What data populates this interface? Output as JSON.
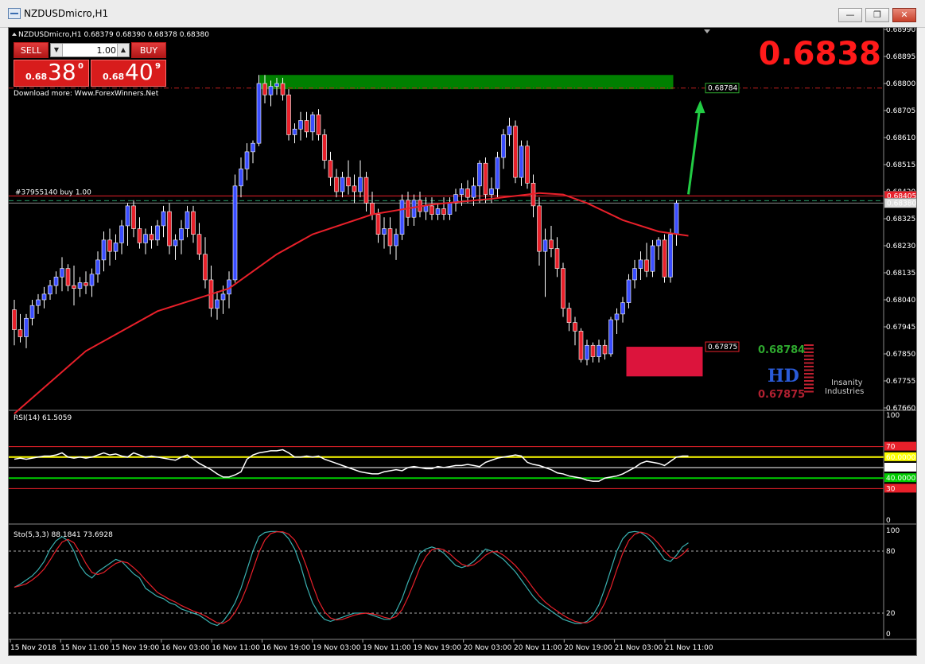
{
  "window": {
    "title": "NZDUSDmicro,H1",
    "controls": {
      "minimize": "—",
      "restore": "❐",
      "close": "✕"
    }
  },
  "chart": {
    "header": "NZDUSDmicro,H1  0.68379 0.68390 0.68378 0.68380",
    "big_price": "0.6838",
    "watermark_text": "Download more: Www.ForexWinners.Net",
    "order_line_label": "#37955140 buy 1.00",
    "trade_panel": {
      "sell_label": "SELL",
      "buy_label": "BUY",
      "lot_value": "1.00",
      "sell_quote": {
        "small": "0.68",
        "big": "38",
        "sup": "0"
      },
      "buy_quote": {
        "small": "0.68",
        "big": "40",
        "sup": "9"
      }
    },
    "price_axis": [
      "0.68990",
      "0.68895",
      "0.68800",
      "0.68705",
      "0.68610",
      "0.68515",
      "0.68420",
      "0.68325",
      "0.68230",
      "0.68135",
      "0.68040",
      "0.67945",
      "0.67850",
      "0.67755",
      "0.67660"
    ],
    "price_tags": {
      "order": "0.68405",
      "bid": "0.68380",
      "target": "0.68784",
      "stop": "0.67875"
    },
    "levels_legend": {
      "upper": "0.68784",
      "lower": "0.67875"
    },
    "logo": {
      "letters": "HD",
      "text1": "Insanity",
      "text2": "Industries"
    },
    "time_axis": [
      "15 Nov 2018",
      "15 Nov 11:00",
      "15 Nov 19:00",
      "16 Nov 03:00",
      "16 Nov 11:00",
      "16 Nov 19:00",
      "19 Nov 03:00",
      "19 Nov 11:00",
      "19 Nov 19:00",
      "20 Nov 03:00",
      "20 Nov 11:00",
      "20 Nov 19:00",
      "21 Nov 03:00",
      "21 Nov 11:00"
    ],
    "colors": {
      "bull": "#3a4dff",
      "bear": "#e8202a",
      "ma": "#e8202a",
      "target_zone": "#008000",
      "stop_zone": "#dc143c",
      "arrow": "#22cc44"
    }
  },
  "rsi": {
    "label": "RSI(14) 61.5059",
    "axis": [
      "100",
      "70",
      "60.0000",
      "50.0000",
      "40.0000",
      "30",
      "0"
    ]
  },
  "stochastic": {
    "label": "Sto(5,3,3) 88.1841 73.6928",
    "axis": [
      "100",
      "80",
      "20",
      "0"
    ]
  },
  "chart_data": {
    "type": "candlestick",
    "symbol": "NZDUSDmicro",
    "timeframe": "H1",
    "ylim": [
      0.6766,
      0.6899
    ],
    "candles": [
      [
        0.68005,
        0.6804,
        0.6788,
        0.67935
      ],
      [
        0.67935,
        0.6799,
        0.6789,
        0.6791
      ],
      [
        0.6791,
        0.6799,
        0.6787,
        0.67975
      ],
      [
        0.67975,
        0.6804,
        0.6795,
        0.6802
      ],
      [
        0.6802,
        0.6806,
        0.6799,
        0.6804
      ],
      [
        0.6804,
        0.68085,
        0.6801,
        0.6806
      ],
      [
        0.6806,
        0.6811,
        0.6804,
        0.6809
      ],
      [
        0.6809,
        0.6814,
        0.6806,
        0.6812
      ],
      [
        0.6812,
        0.6819,
        0.6807,
        0.6815
      ],
      [
        0.6815,
        0.68165,
        0.6807,
        0.6809
      ],
      [
        0.6809,
        0.6816,
        0.6802,
        0.6808
      ],
      [
        0.6808,
        0.6812,
        0.6805,
        0.681
      ],
      [
        0.681,
        0.6814,
        0.6806,
        0.6809
      ],
      [
        0.6809,
        0.6815,
        0.6805,
        0.6813
      ],
      [
        0.6813,
        0.6821,
        0.681,
        0.6818
      ],
      [
        0.6818,
        0.6828,
        0.6814,
        0.6825
      ],
      [
        0.6825,
        0.6829,
        0.6816,
        0.6821
      ],
      [
        0.6821,
        0.6827,
        0.6818,
        0.6824
      ],
      [
        0.6824,
        0.6832,
        0.682,
        0.683
      ],
      [
        0.683,
        0.6838,
        0.6823,
        0.6837
      ],
      [
        0.6837,
        0.6839,
        0.6826,
        0.6829
      ],
      [
        0.6829,
        0.6833,
        0.6822,
        0.6824
      ],
      [
        0.6824,
        0.6829,
        0.682,
        0.6827
      ],
      [
        0.6827,
        0.683,
        0.6822,
        0.6825
      ],
      [
        0.6825,
        0.6832,
        0.6823,
        0.683
      ],
      [
        0.683,
        0.6837,
        0.6826,
        0.6835
      ],
      [
        0.6835,
        0.6838,
        0.682,
        0.6823
      ],
      [
        0.6823,
        0.6827,
        0.6818,
        0.6825
      ],
      [
        0.6825,
        0.6832,
        0.682,
        0.6829
      ],
      [
        0.6829,
        0.6837,
        0.6826,
        0.6835
      ],
      [
        0.6835,
        0.6837,
        0.6824,
        0.6827
      ],
      [
        0.6827,
        0.6831,
        0.6818,
        0.682
      ],
      [
        0.682,
        0.6826,
        0.6808,
        0.6811
      ],
      [
        0.6811,
        0.6816,
        0.6798,
        0.6801
      ],
      [
        0.6801,
        0.6807,
        0.6797,
        0.6804
      ],
      [
        0.6804,
        0.6809,
        0.6799,
        0.6806
      ],
      [
        0.6806,
        0.6814,
        0.6801,
        0.6811
      ],
      [
        0.6811,
        0.6848,
        0.681,
        0.6844
      ],
      [
        0.6844,
        0.6854,
        0.684,
        0.685
      ],
      [
        0.685,
        0.6859,
        0.6846,
        0.6856
      ],
      [
        0.6856,
        0.686,
        0.6852,
        0.6859
      ],
      [
        0.6859,
        0.6883,
        0.6858,
        0.688
      ],
      [
        0.688,
        0.6883,
        0.6873,
        0.6876
      ],
      [
        0.6876,
        0.6881,
        0.6872,
        0.6879
      ],
      [
        0.6879,
        0.6882,
        0.6876,
        0.688
      ],
      [
        0.688,
        0.6882,
        0.6874,
        0.6876
      ],
      [
        0.6876,
        0.6878,
        0.686,
        0.6862
      ],
      [
        0.6862,
        0.6866,
        0.6859,
        0.6864
      ],
      [
        0.6864,
        0.687,
        0.686,
        0.6867
      ],
      [
        0.6867,
        0.687,
        0.6861,
        0.6863
      ],
      [
        0.6863,
        0.687,
        0.686,
        0.6869
      ],
      [
        0.6869,
        0.6871,
        0.686,
        0.6862
      ],
      [
        0.6862,
        0.6864,
        0.685,
        0.6853
      ],
      [
        0.6853,
        0.6856,
        0.6844,
        0.6847
      ],
      [
        0.6847,
        0.685,
        0.684,
        0.6842
      ],
      [
        0.6842,
        0.6849,
        0.684,
        0.6847
      ],
      [
        0.6847,
        0.6853,
        0.6841,
        0.6844
      ],
      [
        0.6844,
        0.6848,
        0.6838,
        0.6842
      ],
      [
        0.6842,
        0.6853,
        0.684,
        0.6847
      ],
      [
        0.6847,
        0.6849,
        0.6835,
        0.6838
      ],
      [
        0.6838,
        0.6842,
        0.6832,
        0.6834
      ],
      [
        0.6834,
        0.6836,
        0.6824,
        0.6827
      ],
      [
        0.6827,
        0.6833,
        0.6822,
        0.6829
      ],
      [
        0.6829,
        0.6833,
        0.682,
        0.6823
      ],
      [
        0.6823,
        0.6829,
        0.6818,
        0.6827
      ],
      [
        0.6827,
        0.6841,
        0.6825,
        0.6839
      ],
      [
        0.6839,
        0.6842,
        0.683,
        0.6833
      ],
      [
        0.6833,
        0.6841,
        0.683,
        0.6839
      ],
      [
        0.6839,
        0.6842,
        0.6833,
        0.6835
      ],
      [
        0.6835,
        0.684,
        0.6832,
        0.6837
      ],
      [
        0.6837,
        0.684,
        0.6832,
        0.6834
      ],
      [
        0.6834,
        0.6838,
        0.6832,
        0.6836
      ],
      [
        0.6836,
        0.684,
        0.6832,
        0.6834
      ],
      [
        0.6834,
        0.684,
        0.6832,
        0.6838
      ],
      [
        0.6838,
        0.6843,
        0.6835,
        0.6841
      ],
      [
        0.6841,
        0.6845,
        0.6837,
        0.6843
      ],
      [
        0.6843,
        0.6846,
        0.6838,
        0.684
      ],
      [
        0.684,
        0.6847,
        0.6837,
        0.6844
      ],
      [
        0.6844,
        0.6853,
        0.6838,
        0.6852
      ],
      [
        0.6852,
        0.6854,
        0.6838,
        0.6841
      ],
      [
        0.6841,
        0.6847,
        0.6838,
        0.6843
      ],
      [
        0.6843,
        0.6856,
        0.684,
        0.6854
      ],
      [
        0.6854,
        0.6864,
        0.685,
        0.6862
      ],
      [
        0.6862,
        0.6868,
        0.6858,
        0.6865
      ],
      [
        0.6865,
        0.6867,
        0.6845,
        0.6847
      ],
      [
        0.6847,
        0.686,
        0.6844,
        0.6858
      ],
      [
        0.6858,
        0.686,
        0.6843,
        0.6845
      ],
      [
        0.6845,
        0.6848,
        0.6833,
        0.6837
      ],
      [
        0.6837,
        0.684,
        0.6816,
        0.6821
      ],
      [
        0.6821,
        0.6829,
        0.6805,
        0.6825
      ],
      [
        0.6825,
        0.683,
        0.6819,
        0.6822
      ],
      [
        0.6822,
        0.6826,
        0.6812,
        0.6815
      ],
      [
        0.6815,
        0.6817,
        0.6798,
        0.6801
      ],
      [
        0.6801,
        0.6803,
        0.6793,
        0.6796
      ],
      [
        0.6796,
        0.6798,
        0.6788,
        0.6793
      ],
      [
        0.6793,
        0.6794,
        0.6782,
        0.6783
      ],
      [
        0.6783,
        0.679,
        0.6781,
        0.6788
      ],
      [
        0.6788,
        0.6789,
        0.6782,
        0.6784
      ],
      [
        0.6784,
        0.679,
        0.6782,
        0.6788
      ],
      [
        0.6788,
        0.679,
        0.6783,
        0.6785
      ],
      [
        0.6785,
        0.6798,
        0.6784,
        0.6797
      ],
      [
        0.6797,
        0.6801,
        0.6792,
        0.6799
      ],
      [
        0.6799,
        0.6805,
        0.6796,
        0.6803
      ],
      [
        0.6803,
        0.6813,
        0.6801,
        0.6811
      ],
      [
        0.6811,
        0.6818,
        0.6808,
        0.6815
      ],
      [
        0.6815,
        0.6821,
        0.6811,
        0.6818
      ],
      [
        0.6818,
        0.6824,
        0.6812,
        0.6814
      ],
      [
        0.6814,
        0.6825,
        0.6812,
        0.6823
      ],
      [
        0.6823,
        0.6826,
        0.6818,
        0.6825
      ],
      [
        0.6825,
        0.6827,
        0.681,
        0.6812
      ],
      [
        0.6812,
        0.6829,
        0.681,
        0.6827
      ],
      [
        0.6827,
        0.6839,
        0.6823,
        0.6838
      ]
    ],
    "ma_line": [
      [
        0,
        0.6764
      ],
      [
        12,
        0.6786
      ],
      [
        24,
        0.68
      ],
      [
        36,
        0.6808
      ],
      [
        44,
        0.682
      ],
      [
        50,
        0.6827
      ],
      [
        60,
        0.6834
      ],
      [
        70,
        0.68375
      ],
      [
        80,
        0.68395
      ],
      [
        86,
        0.6841
      ],
      [
        88,
        0.68415
      ],
      [
        92,
        0.6841
      ],
      [
        96,
        0.6838
      ],
      [
        102,
        0.6832
      ],
      [
        108,
        0.6828
      ],
      [
        113,
        0.68265
      ]
    ],
    "order_price": 0.68405,
    "bid": 0.6838,
    "target_level": 0.68784,
    "stop_level": 0.67875,
    "target_zone": [
      0.6878,
      0.6883
    ],
    "stop_zone": [
      0.6781,
      0.67875
    ],
    "rsi": {
      "levels": [
        70,
        60,
        50,
        40,
        30
      ],
      "values": [
        58,
        59,
        58,
        59,
        60,
        61,
        61,
        62,
        64,
        60,
        59,
        60,
        59,
        60,
        62,
        64,
        62,
        63,
        61,
        60,
        64,
        62,
        60,
        61,
        60,
        59,
        58,
        57,
        60,
        62,
        58,
        54,
        51,
        48,
        44,
        41,
        41,
        43,
        46,
        58,
        62,
        64,
        65,
        66,
        66,
        67,
        64,
        60,
        60,
        61,
        60,
        61,
        58,
        56,
        54,
        52,
        50,
        48,
        46,
        45,
        44,
        44,
        46,
        47,
        48,
        47,
        50,
        51,
        50,
        49,
        49,
        51,
        50,
        51,
        52,
        52,
        53,
        52,
        51,
        55,
        57,
        59,
        60,
        61,
        62,
        61,
        55,
        53,
        52,
        50,
        48,
        45,
        44,
        42,
        41,
        40,
        38,
        37,
        37,
        40,
        41,
        42,
        44,
        47,
        50,
        54,
        56,
        55,
        54,
        52,
        56,
        60,
        61,
        61
      ]
    },
    "stochastic": {
      "levels": [
        80,
        20
      ],
      "k": [
        45,
        48,
        52,
        56,
        62,
        70,
        82,
        90,
        94,
        90,
        80,
        66,
        58,
        54,
        60,
        64,
        68,
        72,
        70,
        64,
        58,
        54,
        44,
        40,
        36,
        34,
        30,
        28,
        24,
        22,
        20,
        18,
        14,
        10,
        8,
        12,
        20,
        30,
        44,
        62,
        80,
        94,
        98,
        99,
        99,
        98,
        92,
        82,
        66,
        46,
        30,
        20,
        14,
        12,
        14,
        16,
        18,
        20,
        20,
        20,
        18,
        16,
        14,
        14,
        22,
        34,
        50,
        64,
        78,
        82,
        84,
        82,
        78,
        72,
        66,
        64,
        66,
        70,
        76,
        82,
        80,
        76,
        72,
        66,
        60,
        52,
        44,
        36,
        30,
        26,
        22,
        18,
        14,
        12,
        10,
        10,
        12,
        18,
        28,
        44,
        62,
        80,
        92,
        98,
        99,
        98,
        94,
        88,
        80,
        72,
        70,
        76,
        84,
        88
      ]
    }
  }
}
